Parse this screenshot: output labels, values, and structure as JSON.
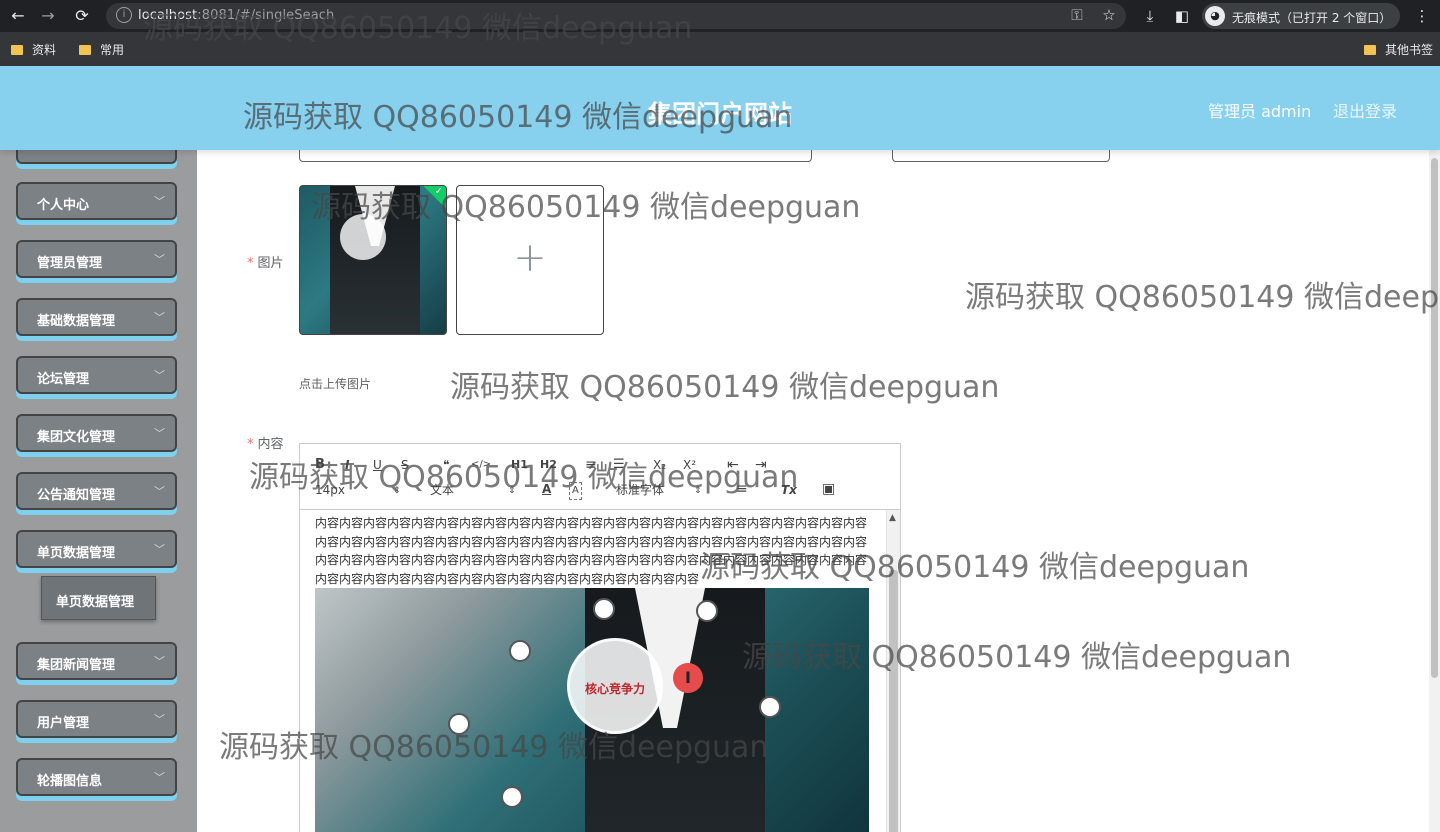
{
  "browser": {
    "url_host": "localhost",
    "url_rest": ":8081/#/singleSeach",
    "incognito_label": "无痕模式（已打开 2 个窗口）",
    "nav": {
      "back": "←",
      "forward": "→",
      "reload": "⟳"
    },
    "icons": {
      "info": "i",
      "key": "⚿",
      "star": "☆",
      "download": "⤓",
      "sidebar": "◧",
      "incognito": "◕",
      "menu": "⋮"
    }
  },
  "bookmarks": {
    "items": [
      "资料",
      "常用"
    ],
    "other": "其他书签",
    "folder_color": "#f1c453"
  },
  "header": {
    "title": "集团门户网站",
    "user": "管理员 admin",
    "logout": "退出登录",
    "bg_color": "#87d1ef"
  },
  "sidebar": {
    "items": [
      {
        "label": "",
        "chevron": "﹀"
      },
      {
        "label": "个人中心",
        "chevron": "﹀"
      },
      {
        "label": "管理员管理",
        "chevron": "﹀"
      },
      {
        "label": "基础数据管理",
        "chevron": "﹀"
      },
      {
        "label": "论坛管理",
        "chevron": "﹀"
      },
      {
        "label": "集团文化管理",
        "chevron": "﹀"
      },
      {
        "label": "公告通知管理",
        "chevron": "﹀"
      },
      {
        "label": "单页数据管理",
        "chevron": "﹀"
      },
      {
        "label": "集团新闻管理",
        "chevron": "﹀"
      },
      {
        "label": "用户管理",
        "chevron": "﹀"
      },
      {
        "label": "轮播图信息",
        "chevron": "﹀"
      }
    ],
    "submenu_item": "单页数据管理"
  },
  "form": {
    "image_label": "图片",
    "required_mark": "*",
    "upload_plus": "+",
    "upload_hint": "点击上传图片",
    "thumb_check": "✓",
    "content_label": "内容"
  },
  "editor": {
    "toolbar": {
      "bold": "B",
      "italic": "I",
      "underline": "U",
      "strike": "S",
      "blockquote": "❝",
      "code": "</>",
      "h1": "H1",
      "h2": "H2",
      "ordered_list": "≡",
      "bullet_list": "☰",
      "subscript": "X₂",
      "superscript": "X²",
      "indent_dec": "⇤",
      "indent_inc": "⇥",
      "font_size": "14px",
      "heading": "文本",
      "font_color": "A",
      "bg_color": "A",
      "font_family": "标准字体",
      "align": "≡",
      "clean": "Tx",
      "image": "▣",
      "select_arrow": "⇕"
    },
    "content_text": "内容内容内容内容内容内容内容内容内容内容内容内容内容内容内容内容内容内容内容内容内容内容内容内容内容内容内容内容内容内容内容内容内容内容内容内容内容内容内容内容内容内容内容内容内容内容内容内容内容内容内容内容内容内容内容内容内容内容内容内容内容内容内容内容内容内容内容内容内容内容内容内容内容内容内容内容内容内容内容内容内容内容内容内容内容",
    "image_caption": "核心竞争力",
    "cursor_glyph": "I",
    "scroll_up": "▲"
  },
  "watermark": "源码获取 QQ86050149 微信deepguan"
}
